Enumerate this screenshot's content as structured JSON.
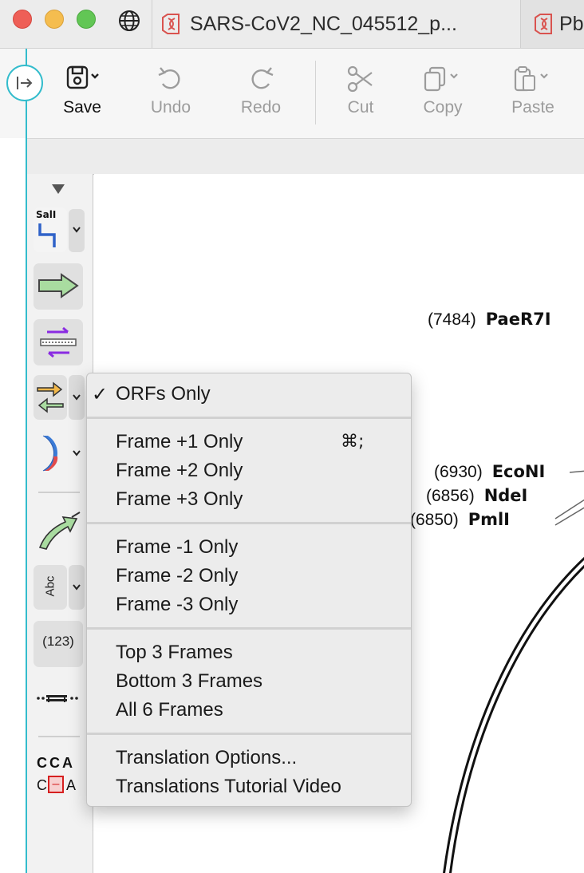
{
  "window": {
    "tabs": [
      {
        "label": "SARS-CoV2_NC_045512_p..."
      },
      {
        "label": "Pb"
      }
    ]
  },
  "toolbar": {
    "save_label": "Save",
    "undo_label": "Undo",
    "redo_label": "Redo",
    "cut_label": "Cut",
    "copy_label": "Copy",
    "paste_label": "Paste"
  },
  "palette": {
    "enzyme_tool_label": "SalI",
    "text_tool_label": "Abc",
    "numbers_tool_label": "(123)",
    "seq_top": "CCA",
    "seq_bottom_left": "C",
    "seq_bottom_mid": "–",
    "seq_bottom_right": "A"
  },
  "map": {
    "sites": [
      {
        "position": "(7484)",
        "enzyme": "PaeR7I"
      },
      {
        "position": "(6930)",
        "enzyme": "EcoNI"
      },
      {
        "position": "(6856)",
        "enzyme": "NdeI"
      },
      {
        "position": "(6850)",
        "enzyme": "PmlI"
      }
    ]
  },
  "menu": {
    "checkmark": "✓",
    "groups": [
      {
        "items": [
          {
            "label": "ORFs Only",
            "checked": true
          }
        ]
      },
      {
        "items": [
          {
            "label": "Frame +1 Only",
            "shortcut": "⌘;"
          },
          {
            "label": "Frame +2 Only"
          },
          {
            "label": "Frame +3 Only"
          }
        ]
      },
      {
        "items": [
          {
            "label": "Frame -1 Only"
          },
          {
            "label": "Frame -2 Only"
          },
          {
            "label": "Frame -3 Only"
          }
        ]
      },
      {
        "items": [
          {
            "label": "Top 3 Frames"
          },
          {
            "label": "Bottom 3 Frames"
          },
          {
            "label": "All 6 Frames"
          }
        ]
      },
      {
        "items": [
          {
            "label": "Translation Options..."
          },
          {
            "label": "Translations Tutorial Video"
          }
        ]
      }
    ]
  },
  "colors": {
    "accent": "#33bccc",
    "close": "#ee5f57",
    "minimize": "#f5bd4f",
    "zoom": "#62c655",
    "tab_icon": "#d9534f"
  }
}
